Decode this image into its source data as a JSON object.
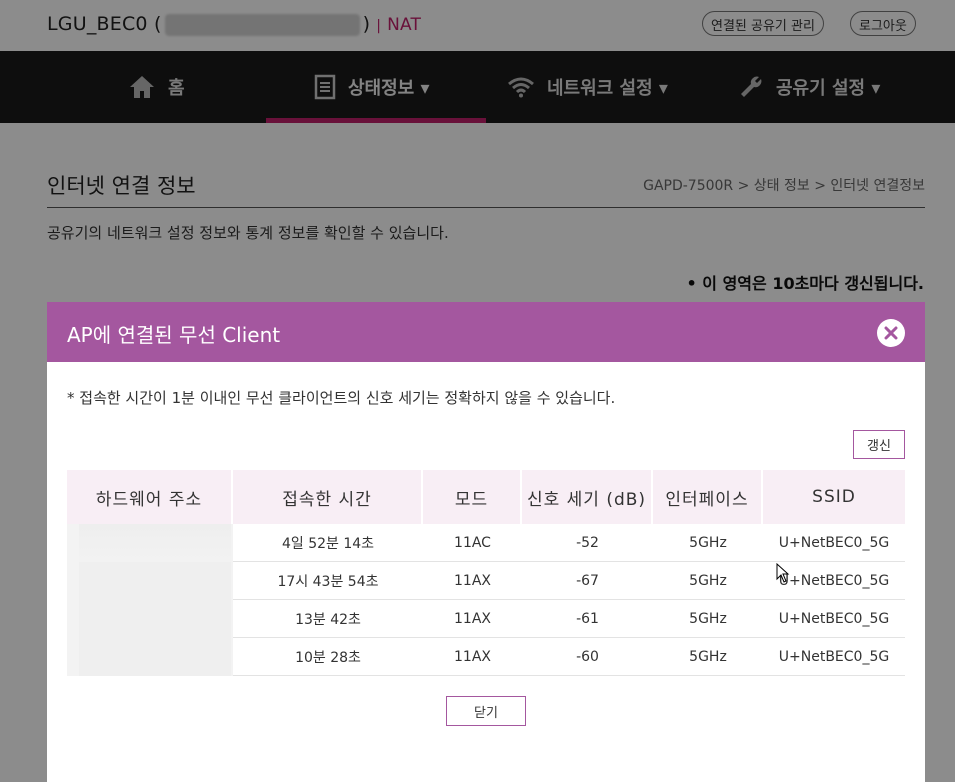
{
  "header": {
    "brand": "LGU_BEC0 (",
    "brand_close": ")",
    "separator": "|",
    "mode": "NAT",
    "connected_router_label": "연결된 공유기 관리",
    "logout_label": "로그아웃"
  },
  "nav": {
    "home": "홈",
    "status": "상태정보 ▾",
    "network": "네트워크 설정 ▾",
    "router": "공유기 설정 ▾"
  },
  "page": {
    "title": "인터넷 연결 정보",
    "breadcrumb": "GAPD-7500R > 상태 정보 > 인터넷 연결정보",
    "description": "공유기의 네트워크 설정 정보와 통계 정보를 확인할 수 있습니다.",
    "refresh_note": "• 이 영역은 10초마다 갱신됩니다."
  },
  "modal": {
    "title": "AP에 연결된 무선 Client",
    "note": "* 접속한 시간이 1분 이내인 무선 클라이언트의 신호 세기는 정확하지 않을 수 있습니다.",
    "refresh_label": "갱신",
    "close_label": "닫기",
    "columns": [
      "하드웨어 주소",
      "접속한 시간",
      "모드",
      "신호 세기 (dB)",
      "인터페이스",
      "SSID"
    ],
    "rows": [
      {
        "time": "4일 52분 14초",
        "mode": "11AC",
        "signal": "-52",
        "iface": "5GHz",
        "ssid": "U+NetBEC0_5G"
      },
      {
        "time": "17시 43분 54초",
        "mode": "11AX",
        "signal": "-67",
        "iface": "5GHz",
        "ssid": "U+NetBEC0_5G"
      },
      {
        "time": "13분 42초",
        "mode": "11AX",
        "signal": "-61",
        "iface": "5GHz",
        "ssid": "U+NetBEC0_5G"
      },
      {
        "time": "10분 28초",
        "mode": "11AX",
        "signal": "-60",
        "iface": "5GHz",
        "ssid": "U+NetBEC0_5G"
      }
    ]
  },
  "colors": {
    "accent": "#c0206a",
    "modal_header": "#a4579f",
    "nav_bg": "#1a1a1a"
  }
}
